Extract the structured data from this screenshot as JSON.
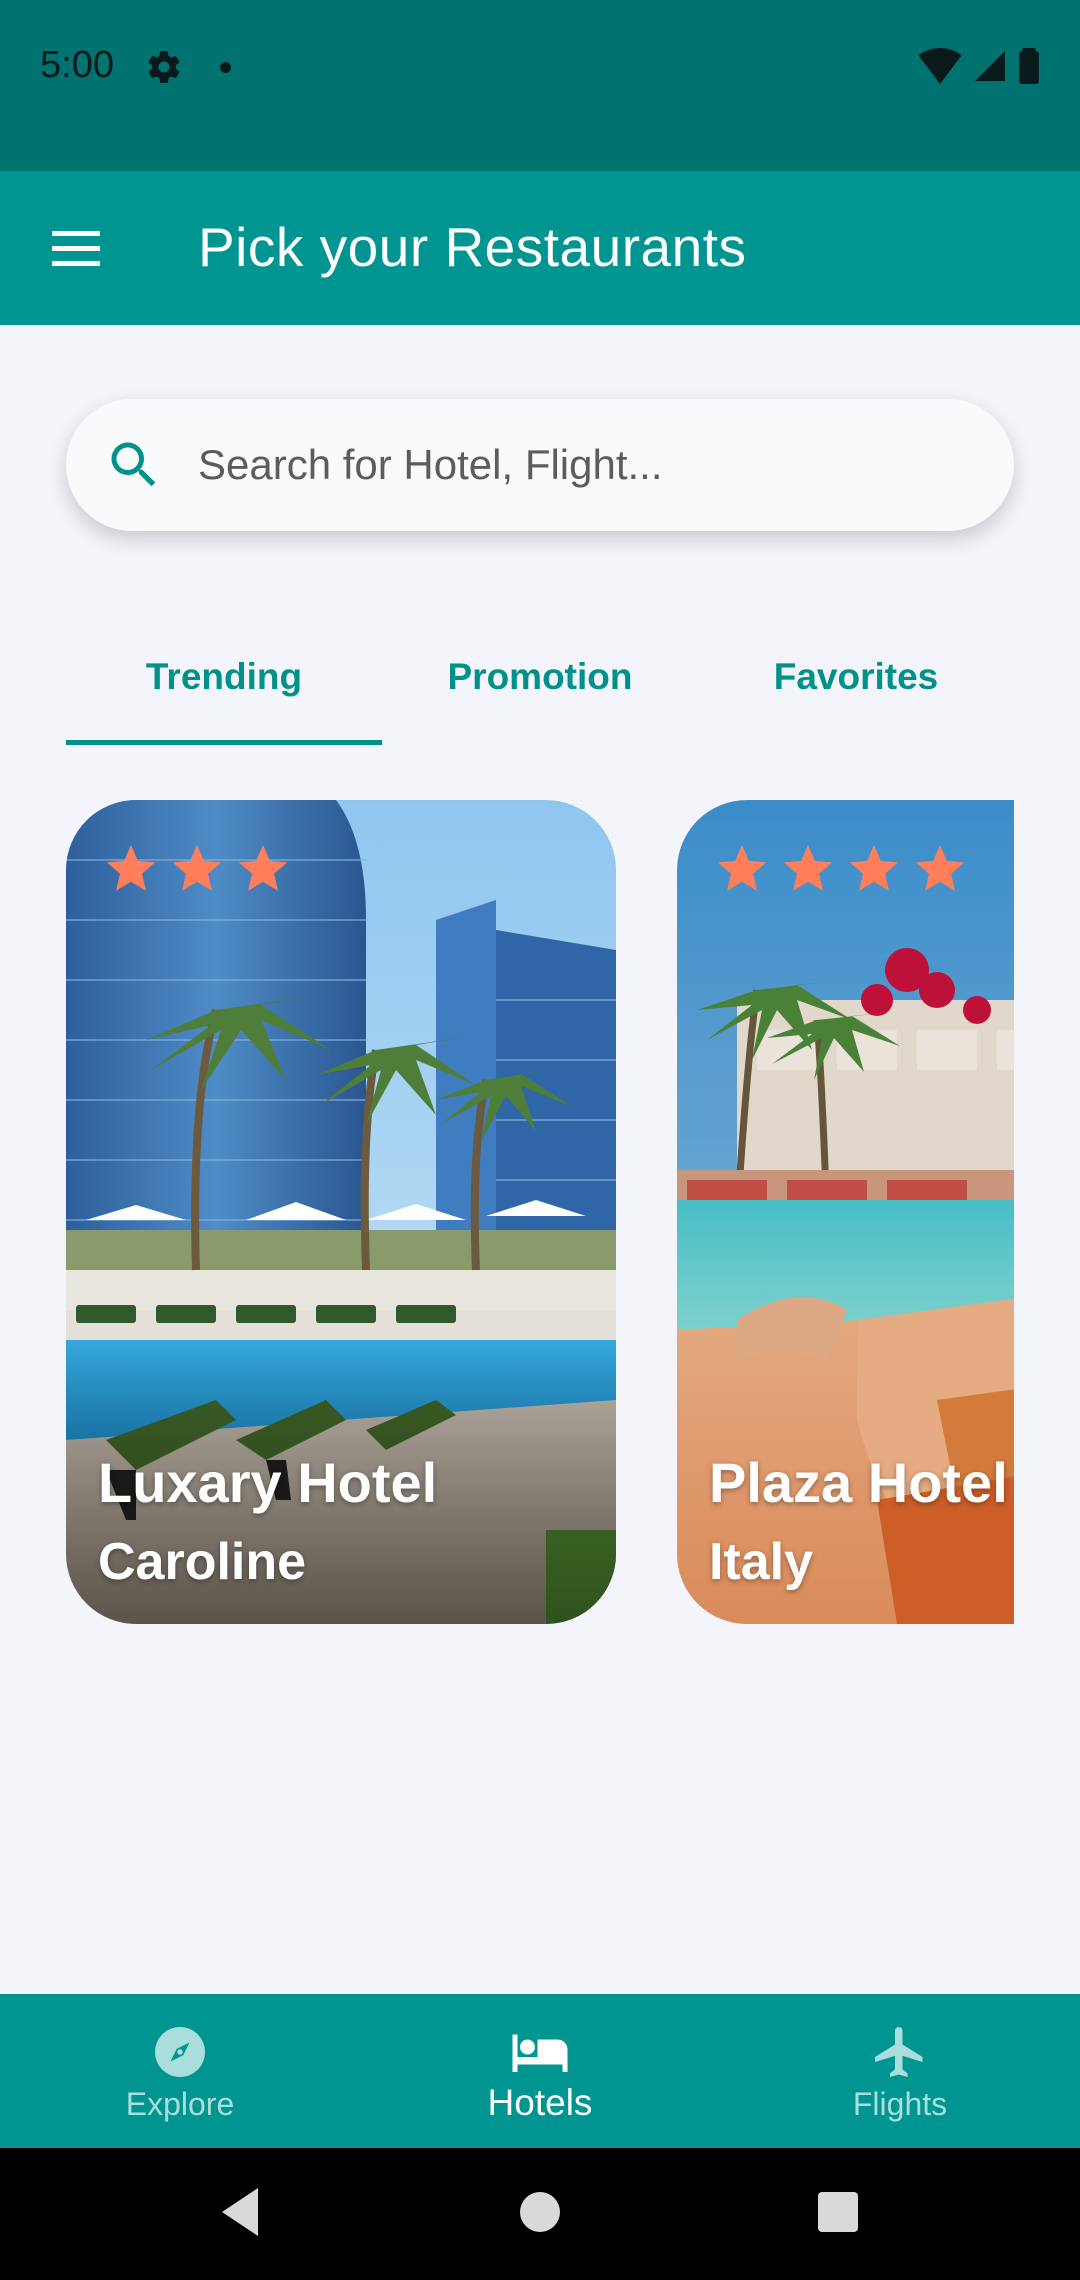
{
  "status_bar": {
    "time": "5:00"
  },
  "app_bar": {
    "title": "Pick your Restaurants"
  },
  "search": {
    "placeholder": "Search for Hotel, Flight..."
  },
  "tabs": [
    {
      "label": "Trending",
      "selected": true
    },
    {
      "label": "Promotion",
      "selected": false
    },
    {
      "label": "Favorites",
      "selected": false
    }
  ],
  "cards": [
    {
      "name": "Luxary Hotel",
      "location": "Caroline",
      "stars": 3
    },
    {
      "name": "Plaza Hotel",
      "location": "Italy",
      "stars": 4
    }
  ],
  "bottom_nav": [
    {
      "label": "Explore",
      "icon": "compass-icon",
      "active": false
    },
    {
      "label": "Hotels",
      "icon": "bed-icon",
      "active": true
    },
    {
      "label": "Flights",
      "icon": "airplane-icon",
      "active": false
    }
  ],
  "colors": {
    "primary": "#009590",
    "status_bar": "#00726f",
    "accent_star": "#ff7f5a",
    "background": "#f4f5fb"
  }
}
